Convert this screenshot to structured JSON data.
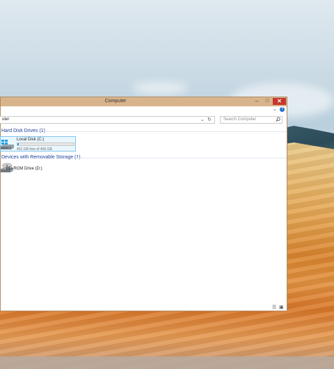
{
  "window": {
    "title": "Computer",
    "buttons": {
      "minimize": "–",
      "maximize": "□",
      "close": "✕"
    }
  },
  "ribbon": {
    "expand_icon": "chevron-down-icon",
    "help_label": "?"
  },
  "address_bar": {
    "value": "uter",
    "dropdown_icon": "chevron-down-icon",
    "refresh_label": "↻"
  },
  "search": {
    "placeholder": "Search Computer",
    "icon": "search-icon"
  },
  "groups": [
    {
      "header": "Hard Disk Drives (1)",
      "items": [
        {
          "name": "Local Disk (C:)",
          "free_text": "451 GB free of 465 GB",
          "used_fraction": 0.03
        }
      ]
    },
    {
      "header": "Devices with Removable Storage (1)",
      "items": [
        {
          "name": "BD-ROM Drive (D:)"
        }
      ]
    }
  ],
  "status_bar": {
    "details_view_icon": "details-view-icon",
    "tiles_view_icon": "tiles-view-icon"
  },
  "colors": {
    "accent": "#26a0da",
    "group_header": "#1f3f99",
    "close_button": "#c7372c",
    "window_frame": "#d8b48c"
  }
}
